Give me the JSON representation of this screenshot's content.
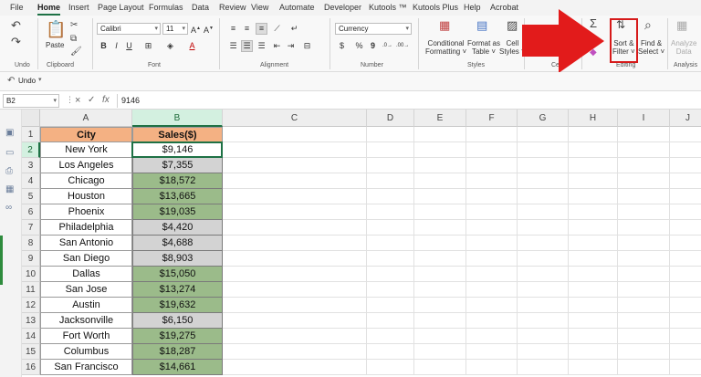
{
  "menu": {
    "tabs": [
      "File",
      "Home",
      "Insert",
      "Page Layout",
      "Formulas",
      "Data",
      "Review",
      "View",
      "Automate",
      "Developer",
      "Kutools ™",
      "Kutools Plus",
      "Help",
      "Acrobat"
    ],
    "active": "Home"
  },
  "ribbon": {
    "groups": {
      "undo": "Undo",
      "clipboard": "Clipboard",
      "font": "Font",
      "alignment": "Alignment",
      "number": "Number",
      "styles": "Styles",
      "cells": "Cells",
      "editing": "Editing",
      "analysis": "Analysis"
    },
    "paste": "Paste",
    "font_name": "Calibri",
    "font_size": "11",
    "number_format": "Currency",
    "conditional_formatting": [
      "Conditional",
      "Formatting ˅"
    ],
    "format_as_table": [
      "Format as",
      "Table ˅"
    ],
    "cell_styles": [
      "Cell",
      "Styles ˅"
    ],
    "sort_filter": [
      "Sort &",
      "Filter ˅"
    ],
    "find_select": [
      "Find &",
      "Select ˅"
    ],
    "analyze_data": [
      "Analyze",
      "Data"
    ],
    "bold": "B",
    "italic": "I",
    "underline": "U",
    "percent": "%",
    "comma": "9"
  },
  "undo_bar": {
    "label": "Undo"
  },
  "formula_bar": {
    "name_box": "B2",
    "fx": "fx",
    "value": "9146"
  },
  "grid": {
    "columns": [
      "A",
      "B",
      "C",
      "D",
      "E",
      "F",
      "G",
      "H",
      "I",
      "J"
    ],
    "rows": [
      "1",
      "2",
      "3",
      "4",
      "5",
      "6",
      "7",
      "8",
      "9",
      "10",
      "11",
      "12",
      "13",
      "14",
      "15",
      "16"
    ],
    "header": {
      "city": "City",
      "sales": "Sales($)"
    },
    "data": [
      {
        "city": "New York",
        "sales": "$9,146",
        "fill": "white"
      },
      {
        "city": "Los Angeles",
        "sales": "$7,355",
        "fill": "gray"
      },
      {
        "city": "Chicago",
        "sales": "$18,572",
        "fill": "green"
      },
      {
        "city": "Houston",
        "sales": "$13,665",
        "fill": "green"
      },
      {
        "city": "Phoenix",
        "sales": "$19,035",
        "fill": "green"
      },
      {
        "city": "Philadelphia",
        "sales": "$4,420",
        "fill": "gray"
      },
      {
        "city": "San Antonio",
        "sales": "$4,688",
        "fill": "gray"
      },
      {
        "city": "San Diego",
        "sales": "$8,903",
        "fill": "gray"
      },
      {
        "city": "Dallas",
        "sales": "$15,050",
        "fill": "green"
      },
      {
        "city": "San Jose",
        "sales": "$13,274",
        "fill": "green"
      },
      {
        "city": "Austin",
        "sales": "$19,632",
        "fill": "green"
      },
      {
        "city": "Jacksonville",
        "sales": "$6,150",
        "fill": "gray"
      },
      {
        "city": "Fort Worth",
        "sales": "$19,275",
        "fill": "green"
      },
      {
        "city": "Columbus",
        "sales": "$18,287",
        "fill": "green"
      },
      {
        "city": "San Francisco",
        "sales": "$14,661",
        "fill": "green"
      }
    ]
  },
  "colors": {
    "accent_green": "#1e7145",
    "header_fill": "#f4b183",
    "high_fill": "#9bbb8a",
    "low_fill": "#d3d3d3",
    "arrow_red": "#e21b1b"
  }
}
